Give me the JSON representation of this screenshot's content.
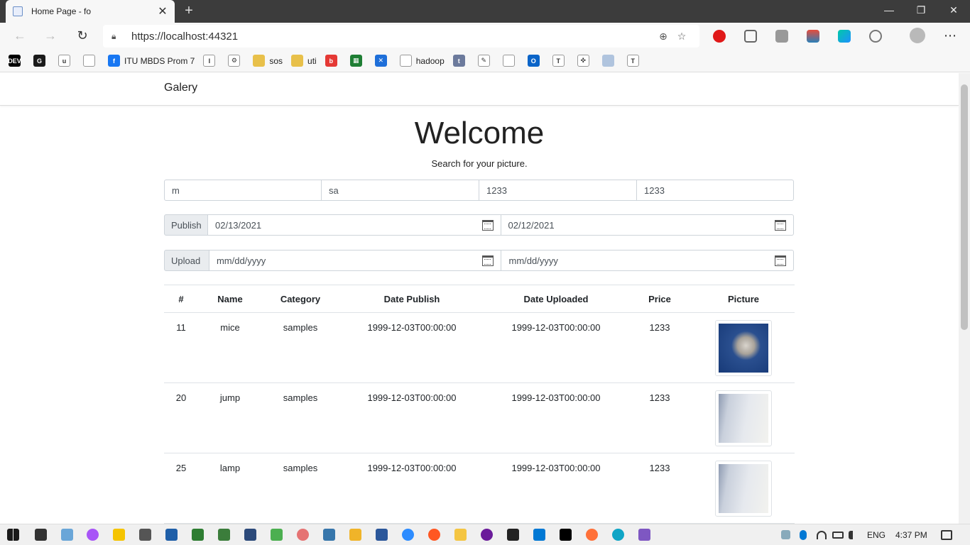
{
  "browser": {
    "tab_title": "Home Page - fo",
    "new_tab_symbol": "+",
    "tab_close_symbol": "✕",
    "url": "https://localhost:44321",
    "window_buttons": {
      "minimize": "—",
      "restore": "❐",
      "close": "✕"
    }
  },
  "bookmarks": [
    {
      "label": "",
      "icon": "dev-icon",
      "color": "#000000",
      "glyph": "DEV"
    },
    {
      "label": "",
      "icon": "grammarly-icon",
      "color": "#1a1a1a",
      "glyph": "G"
    },
    {
      "label": "",
      "icon": "toggl-icon",
      "color": "#ffffff",
      "glyph": "u"
    },
    {
      "label": "",
      "icon": "page-icon",
      "color": "#ffffff",
      "glyph": ""
    },
    {
      "label": "ITU MBDS Prom 7",
      "icon": "facebook-icon",
      "color": "#1877f2",
      "glyph": "f"
    },
    {
      "label": "",
      "icon": "intellij-icon",
      "color": "#ffffff",
      "glyph": "I"
    },
    {
      "label": "",
      "icon": "gear-icon",
      "color": "#ffffff",
      "glyph": "⚙"
    },
    {
      "label": "sos",
      "icon": "folder-icon",
      "color": "#e8c04a",
      "glyph": ""
    },
    {
      "label": "uti",
      "icon": "folder-icon",
      "color": "#e8c04a",
      "glyph": ""
    },
    {
      "label": "",
      "icon": "beats-icon",
      "color": "#e53935",
      "glyph": "b"
    },
    {
      "label": "",
      "icon": "chart-icon",
      "color": "#1e7e34",
      "glyph": "▦"
    },
    {
      "label": "",
      "icon": "xmind-icon",
      "color": "#1e6fd9",
      "glyph": "✕"
    },
    {
      "label": "hadoop",
      "icon": "page-icon",
      "color": "#ffffff",
      "glyph": ""
    },
    {
      "label": "",
      "icon": "tumblr-icon",
      "color": "#6c7a9c",
      "glyph": "t"
    },
    {
      "label": "",
      "icon": "pencil-icon",
      "color": "#ffffff",
      "glyph": "✎"
    },
    {
      "label": "",
      "icon": "page-icon",
      "color": "#ffffff",
      "glyph": ""
    },
    {
      "label": "",
      "icon": "outlook-icon",
      "color": "#0a64c8",
      "glyph": "O"
    },
    {
      "label": "",
      "icon": "t-icon",
      "color": "#ffffff",
      "glyph": "T"
    },
    {
      "label": "",
      "icon": "network-icon",
      "color": "#ffffff",
      "glyph": "✜"
    },
    {
      "label": "",
      "icon": "doc-icon",
      "color": "#b0c4de",
      "glyph": ""
    },
    {
      "label": "",
      "icon": "text-tool-icon",
      "color": "#ffffff",
      "glyph": "T"
    }
  ],
  "navbar": {
    "brand": "Galery"
  },
  "hero": {
    "title": "Welcome",
    "subtitle": "Search for your picture."
  },
  "filters": {
    "name": "m",
    "category": "sa",
    "price_min": "1233",
    "price_max": "1233",
    "publish": {
      "label": "Publish",
      "from": "02/13/2021",
      "to": "02/12/2021"
    },
    "upload": {
      "label": "Upload",
      "from": "mm/dd/yyyy",
      "to": "mm/dd/yyyy"
    }
  },
  "table": {
    "headers": [
      "#",
      "Name",
      "Category",
      "Date Publish",
      "Date Uploaded",
      "Price",
      "Picture"
    ],
    "rows": [
      {
        "id": "11",
        "name": "mice",
        "category": "samples",
        "date_publish": "1999-12-03T00:00:00",
        "date_uploaded": "1999-12-03T00:00:00",
        "price": "1233",
        "picture": "mice"
      },
      {
        "id": "20",
        "name": "jump",
        "category": "samples",
        "date_publish": "1999-12-03T00:00:00",
        "date_uploaded": "1999-12-03T00:00:00",
        "price": "1233",
        "picture": "paper"
      },
      {
        "id": "25",
        "name": "lamp",
        "category": "samples",
        "date_publish": "1999-12-03T00:00:00",
        "date_uploaded": "1999-12-03T00:00:00",
        "price": "1233",
        "picture": "paper"
      }
    ]
  },
  "taskbar": {
    "language": "ENG",
    "time": "4:37 PM"
  }
}
